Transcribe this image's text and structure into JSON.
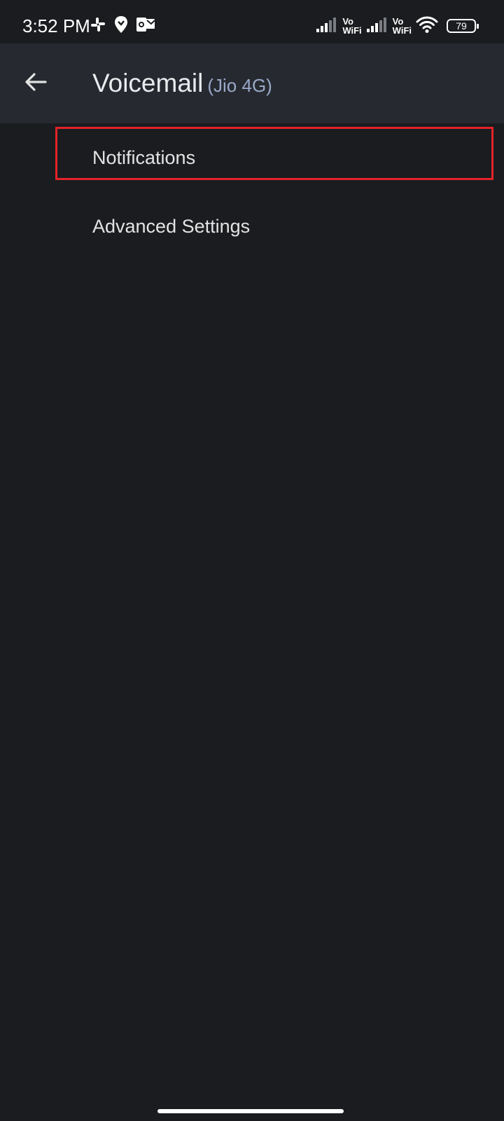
{
  "status_bar": {
    "time": "3:52 PM",
    "left_icons": [
      "slack-icon",
      "location-pin-icon",
      "outlook-mail-icon"
    ],
    "right_icons": [
      "signal-icon",
      "vowifi-icon",
      "signal-icon",
      "vowifi-icon",
      "wifi-icon",
      "battery-icon"
    ],
    "vo_label_1": "Vo",
    "wifi_label_1": "WiFi",
    "vo_label_2": "Vo",
    "wifi_label_2": "WiFi",
    "battery_level": "79"
  },
  "app_bar": {
    "title": "Voicemail",
    "subtitle": "(Jio 4G)",
    "back_icon": "back-arrow-icon"
  },
  "list": {
    "items": [
      {
        "label": "Notifications",
        "highlighted": true
      },
      {
        "label": "Advanced Settings",
        "highlighted": false
      }
    ]
  },
  "colors": {
    "background": "#1a1c1f",
    "app_bar": "#262a30",
    "highlight": "#e3232a",
    "text": "#e3e3e3"
  }
}
